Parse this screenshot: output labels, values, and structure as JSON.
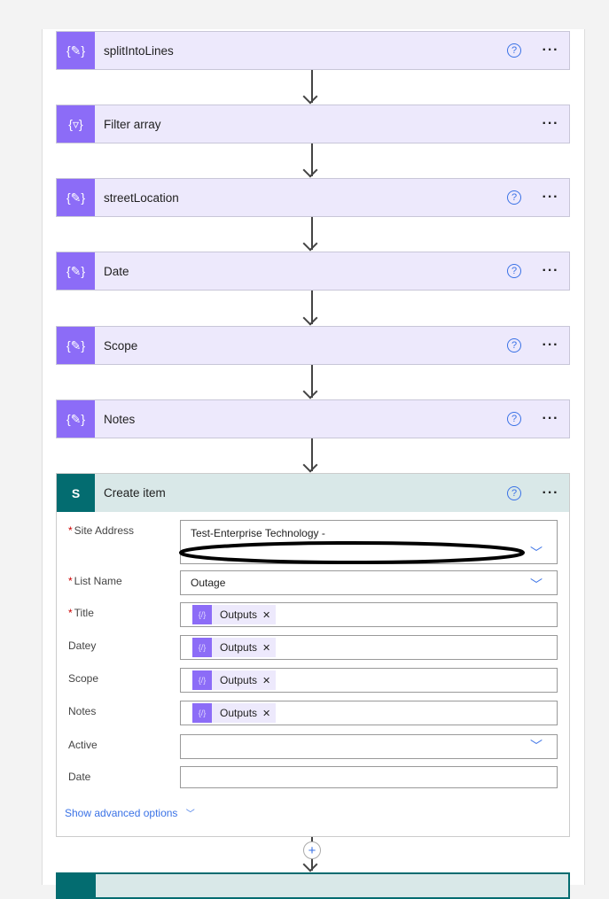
{
  "steps": [
    {
      "title": "splitIntoLines",
      "icon": "compose-icon",
      "help": true
    },
    {
      "title": "Filter array",
      "icon": "filter-icon",
      "help": false
    },
    {
      "title": "streetLocation",
      "icon": "compose-icon",
      "help": true
    },
    {
      "title": "Date",
      "icon": "compose-icon",
      "help": true
    },
    {
      "title": "Scope",
      "icon": "compose-icon",
      "help": true
    },
    {
      "title": "Notes",
      "icon": "compose-icon",
      "help": true
    }
  ],
  "create_item": {
    "title": "Create item",
    "icon_letter": "S",
    "fields": {
      "site_address": {
        "label": "Site Address",
        "value": "Test-Enterprise Technology -"
      },
      "list_name": {
        "label": "List Name",
        "value": "Outage"
      },
      "title": {
        "label": "Title",
        "token": "Outputs"
      },
      "datey": {
        "label": "Datey",
        "token": "Outputs"
      },
      "scope": {
        "label": "Scope",
        "token": "Outputs"
      },
      "notes": {
        "label": "Notes",
        "token": "Outputs"
      },
      "active": {
        "label": "Active",
        "value": ""
      },
      "date": {
        "label": "Date",
        "value": ""
      }
    },
    "advanced": "Show advanced options"
  },
  "help_glyph": "?",
  "more_glyph": "···",
  "colors": {
    "action": "#8c6cf7",
    "sharepoint": "#036c70",
    "link": "#3a72e6"
  }
}
